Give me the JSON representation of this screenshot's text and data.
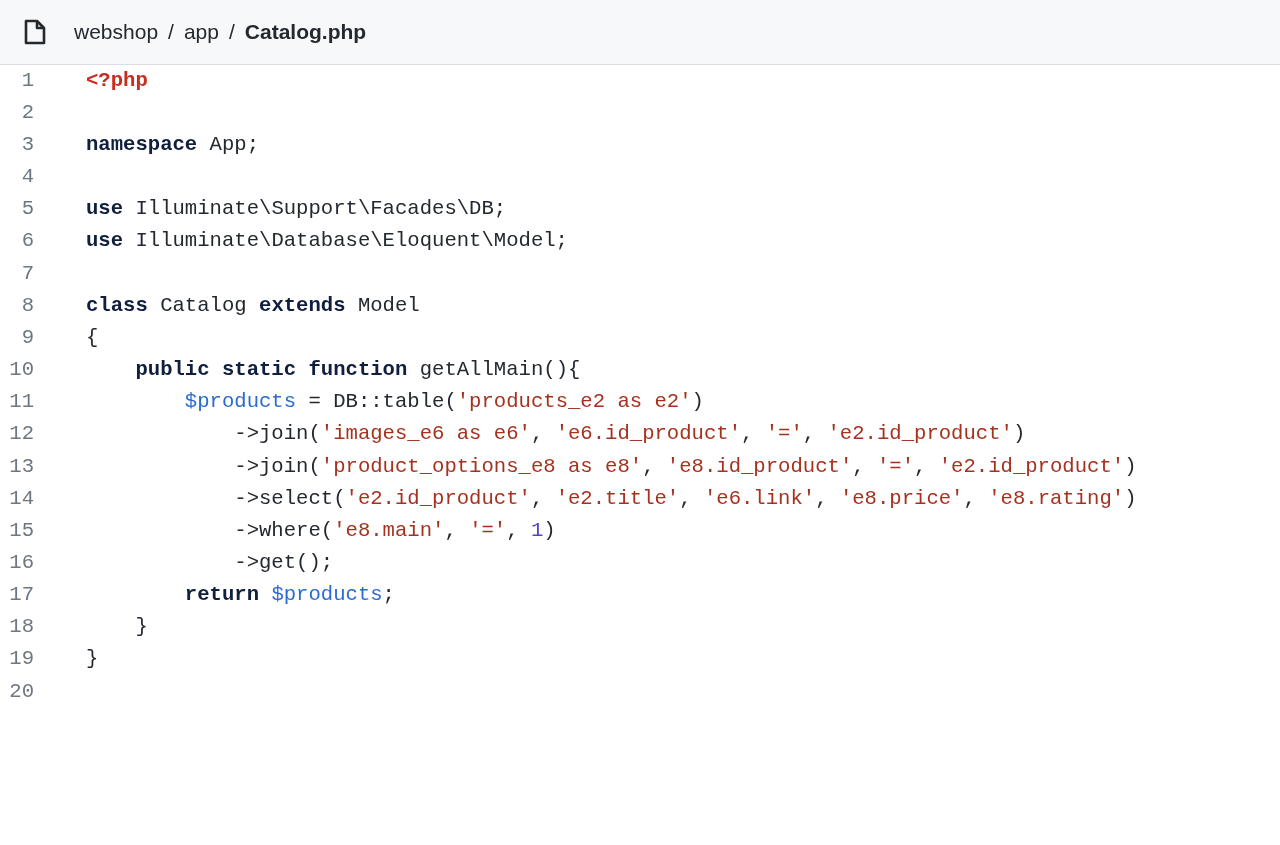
{
  "breadcrumb": [
    {
      "kind": "folder",
      "text": "webshop"
    },
    {
      "kind": "separator",
      "text": "/"
    },
    {
      "kind": "folder",
      "text": "app"
    },
    {
      "kind": "separator",
      "text": "/"
    },
    {
      "kind": "current",
      "text": "Catalog.php"
    }
  ],
  "code": {
    "lines": [
      {
        "number": "1",
        "tokens": [
          {
            "kind": "tag",
            "text": "<?php"
          }
        ]
      },
      {
        "number": "2"
      },
      {
        "number": "3",
        "tokens": [
          {
            "kind": "keyword",
            "text": "namespace"
          },
          {
            "kind": "plain",
            "text": " App;"
          }
        ]
      },
      {
        "number": "4"
      },
      {
        "number": "5",
        "tokens": [
          {
            "kind": "keyword",
            "text": "use"
          },
          {
            "kind": "plain",
            "text": " Illuminate\\Support\\Facades\\DB;"
          }
        ]
      },
      {
        "number": "6",
        "tokens": [
          {
            "kind": "keyword",
            "text": "use"
          },
          {
            "kind": "plain",
            "text": " Illuminate\\Database\\Eloquent\\Model;"
          }
        ]
      },
      {
        "number": "7"
      },
      {
        "number": "8",
        "tokens": [
          {
            "kind": "keyword",
            "text": "class"
          },
          {
            "kind": "plain",
            "text": " Catalog "
          },
          {
            "kind": "keyword",
            "text": "extends"
          },
          {
            "kind": "plain",
            "text": " Model"
          }
        ]
      },
      {
        "number": "9",
        "tokens": [
          {
            "kind": "plain",
            "text": "{"
          }
        ]
      },
      {
        "number": "10",
        "tokens": [
          {
            "kind": "keyword",
            "text": "    public static function"
          },
          {
            "kind": "plain",
            "text": " getAllMain(){"
          }
        ]
      },
      {
        "number": "11",
        "tokens": [
          {
            "kind": "variable",
            "text": "        $products"
          },
          {
            "kind": "plain",
            "text": " = DB::table("
          },
          {
            "kind": "string",
            "text": "'products_e2 as e2'"
          },
          {
            "kind": "plain",
            "text": ")"
          }
        ]
      },
      {
        "number": "12",
        "tokens": [
          {
            "kind": "plain",
            "text": "            ->join("
          },
          {
            "kind": "string",
            "text": "'images_e6 as e6'"
          },
          {
            "kind": "plain",
            "text": ", "
          },
          {
            "kind": "string",
            "text": "'e6.id_product'"
          },
          {
            "kind": "plain",
            "text": ", "
          },
          {
            "kind": "string",
            "text": "'='"
          },
          {
            "kind": "plain",
            "text": ", "
          },
          {
            "kind": "string",
            "text": "'e2.id_product'"
          },
          {
            "kind": "plain",
            "text": ")"
          }
        ]
      },
      {
        "number": "13",
        "tokens": [
          {
            "kind": "plain",
            "text": "            ->join("
          },
          {
            "kind": "string",
            "text": "'product_options_e8 as e8'"
          },
          {
            "kind": "plain",
            "text": ", "
          },
          {
            "kind": "string",
            "text": "'e8.id_product'"
          },
          {
            "kind": "plain",
            "text": ", "
          },
          {
            "kind": "string",
            "text": "'='"
          },
          {
            "kind": "plain",
            "text": ", "
          },
          {
            "kind": "string",
            "text": "'e2.id_product'"
          },
          {
            "kind": "plain",
            "text": ")"
          }
        ]
      },
      {
        "number": "14",
        "tokens": [
          {
            "kind": "plain",
            "text": "            ->select("
          },
          {
            "kind": "string",
            "text": "'e2.id_product'"
          },
          {
            "kind": "plain",
            "text": ", "
          },
          {
            "kind": "string",
            "text": "'e2.title'"
          },
          {
            "kind": "plain",
            "text": ", "
          },
          {
            "kind": "string",
            "text": "'e6.link'"
          },
          {
            "kind": "plain",
            "text": ", "
          },
          {
            "kind": "string",
            "text": "'e8.price'"
          },
          {
            "kind": "plain",
            "text": ", "
          },
          {
            "kind": "string",
            "text": "'e8.rating'"
          },
          {
            "kind": "plain",
            "text": ")"
          }
        ]
      },
      {
        "number": "15",
        "tokens": [
          {
            "kind": "plain",
            "text": "            ->where("
          },
          {
            "kind": "string",
            "text": "'e8.main'"
          },
          {
            "kind": "plain",
            "text": ", "
          },
          {
            "kind": "string",
            "text": "'='"
          },
          {
            "kind": "plain",
            "text": ", "
          },
          {
            "kind": "number",
            "text": "1"
          },
          {
            "kind": "plain",
            "text": ")"
          }
        ]
      },
      {
        "number": "16",
        "tokens": [
          {
            "kind": "plain",
            "text": "            ->get();"
          }
        ]
      },
      {
        "number": "17",
        "tokens": [
          {
            "kind": "keyword",
            "text": "        return "
          },
          {
            "kind": "variable",
            "text": "$products"
          },
          {
            "kind": "plain",
            "text": ";"
          }
        ]
      },
      {
        "number": "18",
        "tokens": [
          {
            "kind": "plain",
            "text": "    }"
          }
        ]
      },
      {
        "number": "19",
        "tokens": [
          {
            "kind": "plain",
            "text": "}"
          }
        ]
      },
      {
        "number": "20"
      }
    ]
  }
}
